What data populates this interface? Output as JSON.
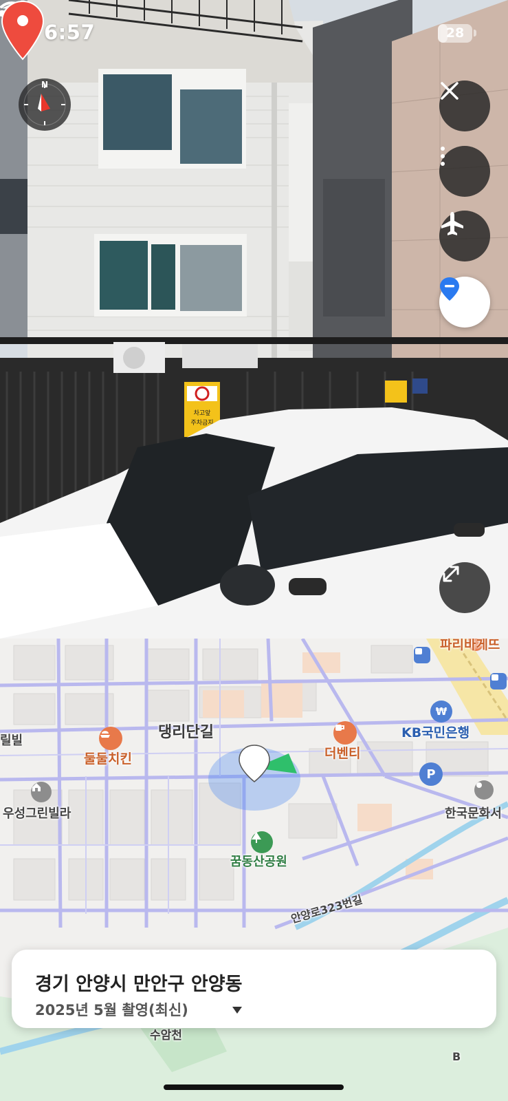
{
  "status_bar": {
    "time": "6:57",
    "battery": "28",
    "battery_fraction": 0.28
  },
  "streetview": {
    "compass_label": "N",
    "sign_text_1": "차고앞",
    "sign_text_2": "주차금지",
    "icons": [
      "close-icon",
      "more-vertical-icon",
      "airplane-icon",
      "location-pin-icon",
      "expand-icon"
    ]
  },
  "map": {
    "labels": {
      "street_1": "댕리단길",
      "restaurant_1": "둘둘치킨",
      "cafe_1": "더벤티",
      "bank_1": "KB국민은행",
      "bakery_1": "파리바게뜨",
      "villa_1": "우성그린빌라",
      "villa_left": "릴빌",
      "park_1": "꿈동산공원",
      "culture_1": "한국문화서",
      "road_1": "안양로323번길",
      "stream_1": "수암천",
      "edge_b": "B"
    }
  },
  "location_card": {
    "address": "경기 안양시 만안구 안양동",
    "capture_date": "2025년 5월 촬영(최신)"
  },
  "colors": {
    "road_purple": "#b9b8ee",
    "pin_red": "#ee4b3e",
    "accent_blue": "#2a7af0",
    "map_bg": "#f1f0ee"
  }
}
